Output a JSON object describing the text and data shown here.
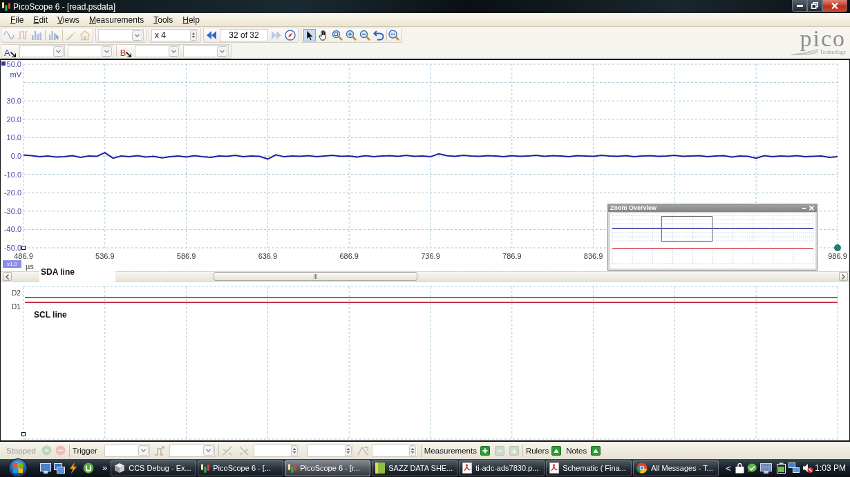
{
  "window": {
    "title": "PicoScope 6 - [read.psdata]"
  },
  "menu": [
    {
      "label": "File"
    },
    {
      "label": "Edit"
    },
    {
      "label": "Views"
    },
    {
      "label": "Measurements"
    },
    {
      "label": "Tools"
    },
    {
      "label": "Help"
    }
  ],
  "toolbar": {
    "view_buttons": [
      {
        "disabled": true
      },
      {
        "disabled": true
      },
      {
        "disabled": true
      },
      {
        "disabled": true
      }
    ],
    "setup_buttons": [
      {
        "disabled": true
      },
      {
        "disabled": true
      }
    ],
    "zoom_factor": "x 4",
    "buffer": {
      "back_disabled": false,
      "position": "32 of 32",
      "forward_disabled": true
    },
    "tools": [
      {
        "selected": true
      },
      {
        "selected": false
      },
      {
        "selected": false
      },
      {
        "selected": false
      },
      {
        "selected": false
      },
      {
        "selected": false
      }
    ]
  },
  "logo": {
    "name": "pico",
    "tagline": "Technology"
  },
  "channel_bar": {
    "channels": [
      {
        "label": "A",
        "color": "#3636b0"
      },
      {
        "label": "B",
        "color": "#c83232"
      }
    ]
  },
  "scope": {
    "chart_data": {
      "type": "line",
      "grid": true,
      "xlabel": "µs",
      "ylabel": "mV",
      "xlim": [
        486.9,
        986.9
      ],
      "ylim": [
        -50,
        50
      ],
      "xticks": [
        486.9,
        536.9,
        586.9,
        636.9,
        686.9,
        736.9,
        786.9,
        836.9,
        986.9
      ],
      "yticks": [
        {
          "value": 50,
          "label": "50.0"
        },
        {
          "value": 30,
          "label": "30.0"
        },
        {
          "value": 20,
          "label": "20.0"
        },
        {
          "value": 10,
          "label": "10.0"
        },
        {
          "value": 0,
          "label": "0.0"
        },
        {
          "value": -10,
          "label": "-10.0"
        },
        {
          "value": -20,
          "label": "-20.0"
        },
        {
          "value": -30,
          "label": "-30.0"
        },
        {
          "value": -40,
          "label": "-40.0"
        },
        {
          "value": -50,
          "label": "-50.0"
        }
      ],
      "x": [
        486.9,
        491.9,
        496.9,
        501.9,
        506.9,
        511.9,
        516.9,
        521.9,
        526.9,
        531.9,
        536.9,
        541.9,
        546.9,
        551.9,
        556.9,
        561.9,
        566.9,
        571.9,
        576.9,
        581.9,
        586.9,
        591.9,
        596.9,
        601.9,
        606.9,
        611.9,
        616.9,
        621.9,
        626.9,
        631.9,
        636.9,
        641.9,
        646.9,
        651.9,
        656.9,
        661.9,
        666.9,
        671.9,
        676.9,
        681.9,
        686.9,
        691.9,
        696.9,
        701.9,
        706.9,
        711.9,
        716.9,
        721.9,
        726.9,
        731.9,
        736.9,
        741.9,
        746.9,
        751.9,
        756.9,
        761.9,
        766.9,
        771.9,
        776.9,
        781.9,
        786.9,
        791.9,
        796.9,
        801.9,
        806.9,
        811.9,
        816.9,
        821.9,
        826.9,
        831.9,
        836.9,
        841.9,
        846.9,
        851.9,
        856.9,
        861.9,
        866.9,
        871.9,
        876.9,
        881.9,
        886.9,
        891.9,
        896.9,
        901.9,
        906.9,
        911.9,
        916.9,
        921.9,
        926.9,
        931.9,
        936.9,
        941.9,
        946.9,
        951.9,
        956.9,
        961.9,
        966.9,
        971.9,
        976.9,
        981.9,
        986.9
      ],
      "series": [
        {
          "color": "#1e1e9e",
          "values": [
            0.6,
            0.2,
            -0.4,
            0.0,
            -0.6,
            -0.4,
            0.2,
            -0.8,
            0.0,
            -0.2,
            1.8,
            -1.2,
            0.0,
            -0.4,
            0.2,
            -0.6,
            -0.2,
            -1.0,
            -0.4,
            0.0,
            -0.6,
            0.2,
            -0.4,
            -0.8,
            0.0,
            -0.2,
            0.4,
            -0.4,
            0.0,
            -0.2,
            -1.6,
            0.6,
            -0.4,
            0.0,
            -0.2,
            0.2,
            -0.4,
            0.0,
            0.4,
            -0.2,
            0.0,
            -0.6,
            0.2,
            -0.4,
            0.0,
            0.2,
            -0.2,
            0.4,
            -0.2,
            0.0,
            -0.4,
            1.2,
            0.2,
            -0.2,
            0.4,
            0.0,
            -0.2,
            0.2,
            0.0,
            -0.4,
            0.2,
            -0.2,
            0.0,
            0.4,
            -0.2,
            0.2,
            0.0,
            -0.4,
            0.2,
            0.0,
            -0.2,
            0.4,
            0.0,
            -0.2,
            0.2,
            -0.4,
            0.0,
            0.2,
            -0.2,
            0.0,
            0.4,
            -0.2,
            0.0,
            0.2,
            -0.4,
            0.0,
            0.2,
            -0.6,
            0.0,
            -0.2,
            -1.2,
            0.2,
            -0.4,
            0.0,
            -0.2,
            0.2,
            -0.4,
            -0.2,
            0.0,
            -0.8,
            -0.4
          ]
        }
      ]
    },
    "zoom_tag": "x1.0"
  },
  "zoom_overview": {
    "title": "Zoom Overview"
  },
  "notes": [
    {
      "text": "SDA line"
    },
    {
      "text": "SCL line"
    }
  ],
  "digital": {
    "channels": [
      {
        "label": "D2",
        "color": "#23957c"
      },
      {
        "label": "D1",
        "color": "#c8344a"
      }
    ]
  },
  "status_bar": {
    "state": "Stopped",
    "run_disabled": true,
    "stop_disabled": true,
    "trigger_label": "Trigger",
    "trigger_controls_disabled": true,
    "measurements_label": "Measurements",
    "add_measurement_disabled": false,
    "remove_measurement_disabled": true,
    "edit_measurement_disabled": true,
    "rulers_label": "Rulers",
    "notes_label": "Notes"
  },
  "taskbar": {
    "overflow": "»",
    "tasks": [
      {
        "kind": "program",
        "label": "CCS Debug - Ex...",
        "selected": false
      },
      {
        "kind": "scope",
        "label": "PicoScope 6 - [...",
        "selected": false
      },
      {
        "kind": "scope",
        "label": "PicoScope 6 - [r...",
        "selected": true
      },
      {
        "kind": "document",
        "label": "SAZZ DATA SHE...",
        "selected": false
      },
      {
        "kind": "pdf",
        "label": "ti-adc-ads7830.p...",
        "selected": false
      },
      {
        "kind": "pdf",
        "label": "Schematic ( Fina...",
        "selected": false
      },
      {
        "kind": "browser",
        "label": "All Messages - T...",
        "selected": false
      }
    ],
    "tray_expander": "<",
    "clock": "1:03 PM"
  }
}
